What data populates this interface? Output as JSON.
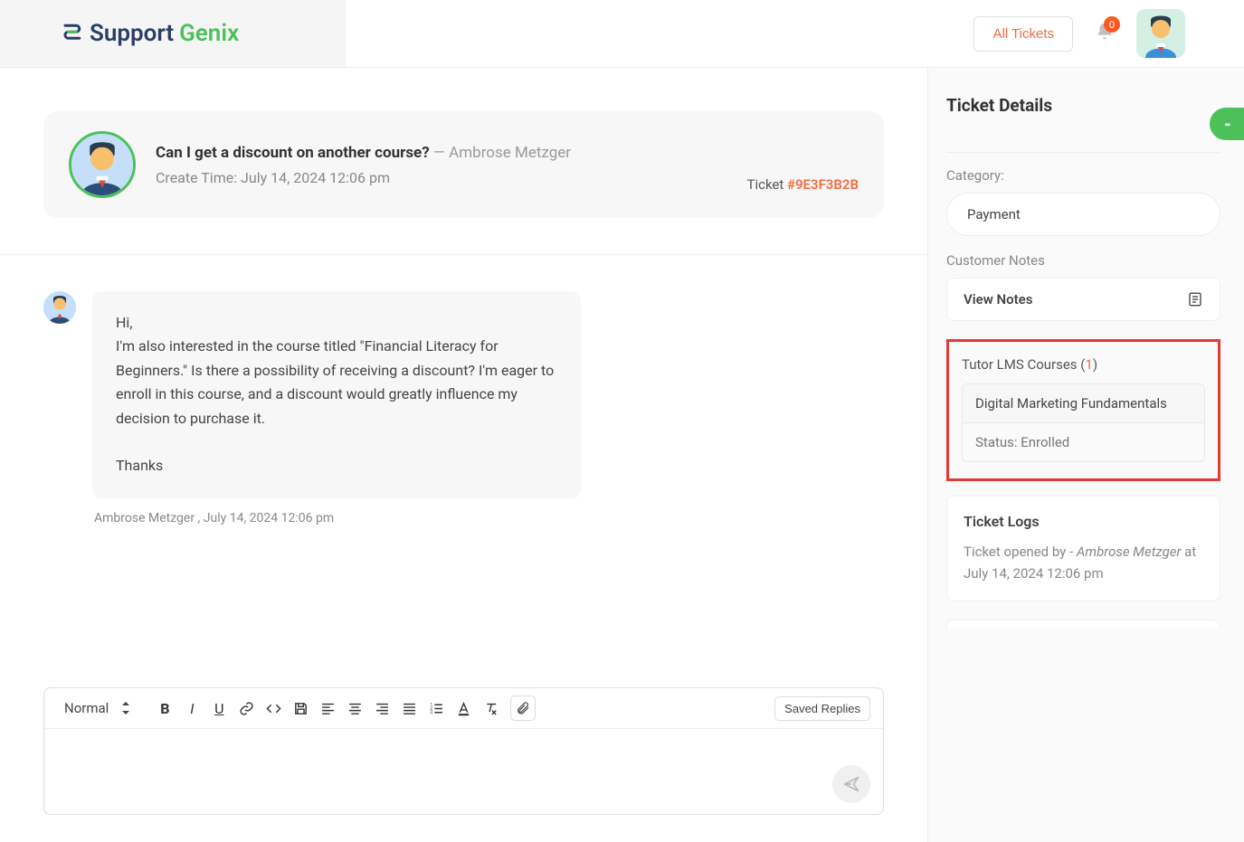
{
  "header": {
    "logo_part1": "Support",
    "logo_part2": "Genix",
    "all_tickets_label": "All Tickets",
    "notification_count": "0"
  },
  "ticket": {
    "subject": "Can I get a discount on another course?",
    "author": "Ambrose Metzger",
    "create_time_label": "Create Time:",
    "create_time_value": "July 14, 2024 12:06 pm",
    "ticket_label": "Ticket ",
    "ticket_id": "#9E3F3B2B"
  },
  "message": {
    "body_line1": "Hi,",
    "body_line2": "I'm also interested in the course titled \"Financial Literacy for Beginners.\" Is there a possibility of receiving a discount? I'm eager to enroll in this course, and a discount would greatly influence my decision to purchase it.",
    "body_line3": "Thanks",
    "meta": "Ambrose Metzger , July 14, 2024 12:06 pm"
  },
  "editor": {
    "format_label": "Normal",
    "saved_replies_label": "Saved Replies",
    "placeholder": ""
  },
  "sidebar": {
    "title": "Ticket Details",
    "collapse_glyph": "-",
    "category_label": "Category:",
    "category_value": "Payment",
    "notes_label": "Customer Notes",
    "view_notes_label": "View Notes",
    "lms_label_prefix": "Tutor LMS Courses (",
    "lms_count": "1",
    "lms_label_suffix": ")",
    "course_name": "Digital Marketing Fundamentals",
    "course_status": "Status: Enrolled",
    "logs_title": "Ticket Logs",
    "log_prefix": "Ticket opened by - ",
    "log_user": "Ambrose Metzger",
    "log_suffix": " at July 14, 2024 12:06 pm"
  }
}
